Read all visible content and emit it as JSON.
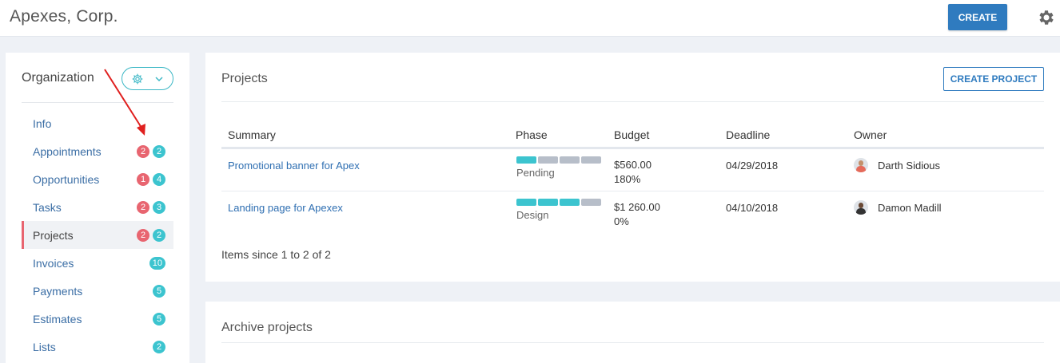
{
  "header": {
    "company": "Apexes, Corp.",
    "create_label": "CREATE",
    "settings_icon": "gear-icon"
  },
  "sidebar": {
    "title": "Organization",
    "settings_button_icons": [
      "gear-icon",
      "chevron-down-icon"
    ],
    "items": [
      {
        "label": "Info",
        "badges": []
      },
      {
        "label": "Appointments",
        "badges": [
          {
            "value": "2",
            "color": "red"
          },
          {
            "value": "2",
            "color": "teal"
          }
        ]
      },
      {
        "label": "Opportunities",
        "badges": [
          {
            "value": "1",
            "color": "red"
          },
          {
            "value": "4",
            "color": "teal"
          }
        ]
      },
      {
        "label": "Tasks",
        "badges": [
          {
            "value": "2",
            "color": "red"
          },
          {
            "value": "3",
            "color": "teal"
          }
        ]
      },
      {
        "label": "Projects",
        "active": true,
        "badges": [
          {
            "value": "2",
            "color": "red"
          },
          {
            "value": "2",
            "color": "teal"
          }
        ]
      },
      {
        "label": "Invoices",
        "badges": [
          {
            "value": "10",
            "color": "teal"
          }
        ]
      },
      {
        "label": "Payments",
        "badges": [
          {
            "value": "5",
            "color": "teal"
          }
        ]
      },
      {
        "label": "Estimates",
        "badges": [
          {
            "value": "5",
            "color": "teal"
          }
        ]
      },
      {
        "label": "Lists",
        "badges": [
          {
            "value": "2",
            "color": "teal"
          }
        ]
      }
    ]
  },
  "projects": {
    "title": "Projects",
    "create_label": "CREATE PROJECT",
    "columns": [
      "Summary",
      "Phase",
      "Budget",
      "Deadline",
      "Owner"
    ],
    "rows": [
      {
        "summary": "Promotional banner for Apex",
        "phase": "Pending",
        "phase_progress": "1/4",
        "budget": "$560.00",
        "budget_pct": "180%",
        "deadline": "04/29/2018",
        "owner": "Darth Sidious"
      },
      {
        "summary": "Landing page for Apexex",
        "phase": "Design",
        "phase_progress": "3/4",
        "budget": "$1 260.00",
        "budget_pct": "0%",
        "deadline": "04/10/2018",
        "owner": "Damon Madill"
      }
    ],
    "items_text": "Items since 1 to 2 of 2"
  },
  "archive": {
    "title": "Archive projects"
  },
  "colors": {
    "accent": "#2f7bbf",
    "teal": "#3cc4cf",
    "red": "#e86570",
    "annotation_arrow": "#e0201f"
  }
}
